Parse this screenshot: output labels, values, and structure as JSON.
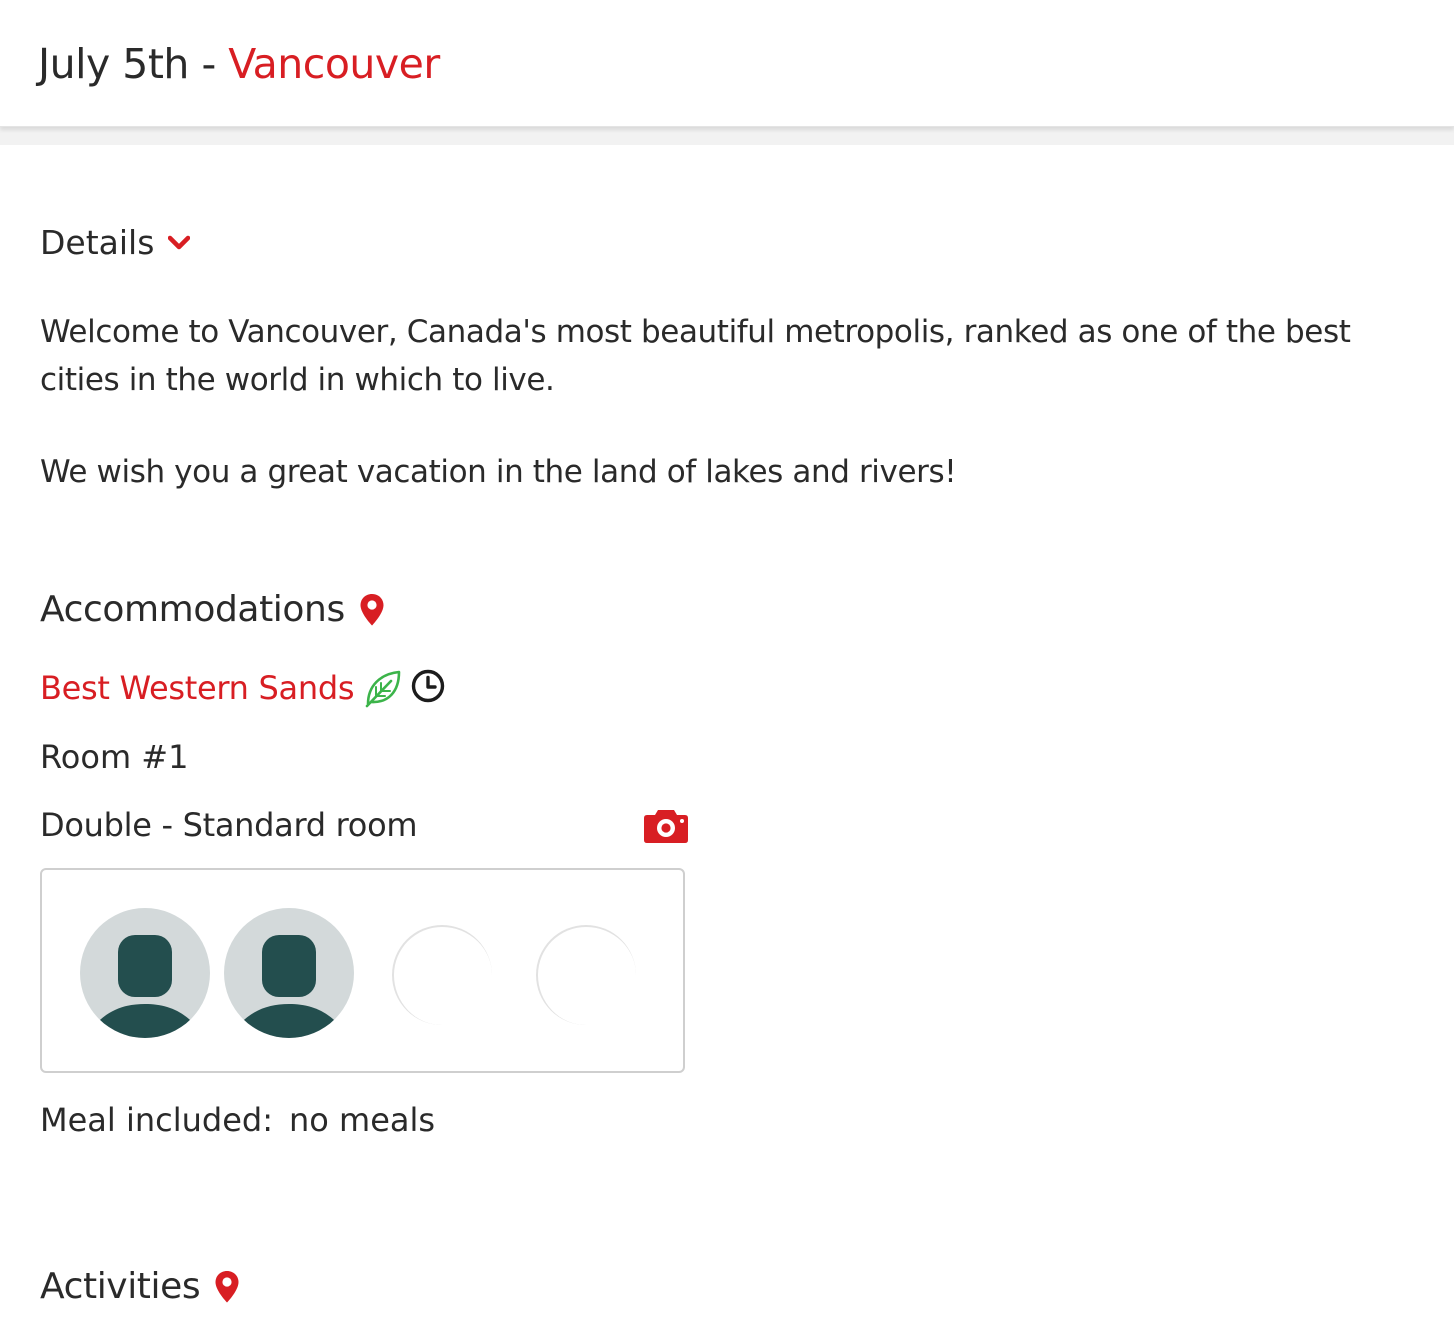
{
  "header": {
    "date": "July 5th",
    "separator": " - ",
    "city": "Vancouver"
  },
  "details": {
    "toggle_label": "Details",
    "toggle_icon": "chevron-down-icon",
    "paragraphs": [
      "Welcome to Vancouver, Canada's most beautiful metropolis, ranked as one of the best cities in the world in which to live.",
      "We wish you a great vacation in the land of lakes and rivers!"
    ]
  },
  "accommodations": {
    "title": "Accommodations",
    "title_icon": "map-pin-icon",
    "hotel_name": "Best Western Sands",
    "hotel_icons": [
      "eco-leaf-icon",
      "clock-icon"
    ],
    "room_label": "Room #1",
    "room_type": "Double - Standard room",
    "photo_icon": "camera-icon",
    "occupants": [
      {
        "state": "filled",
        "icon": "person-avatar-icon"
      },
      {
        "state": "filled",
        "icon": "person-avatar-icon"
      },
      {
        "state": "empty",
        "icon": "empty-slot-icon"
      },
      {
        "state": "empty",
        "icon": "empty-slot-icon"
      }
    ],
    "meal_label": "Meal included:",
    "meal_value": "no meals"
  },
  "activities": {
    "title": "Activities",
    "title_icon": "map-pin-icon"
  },
  "colors": {
    "accent": "#d81e23",
    "text": "#2a2a2a",
    "leaf": "#3cb44a",
    "avatar_bg": "#d3d9da",
    "avatar_fg": "#234e4e"
  }
}
